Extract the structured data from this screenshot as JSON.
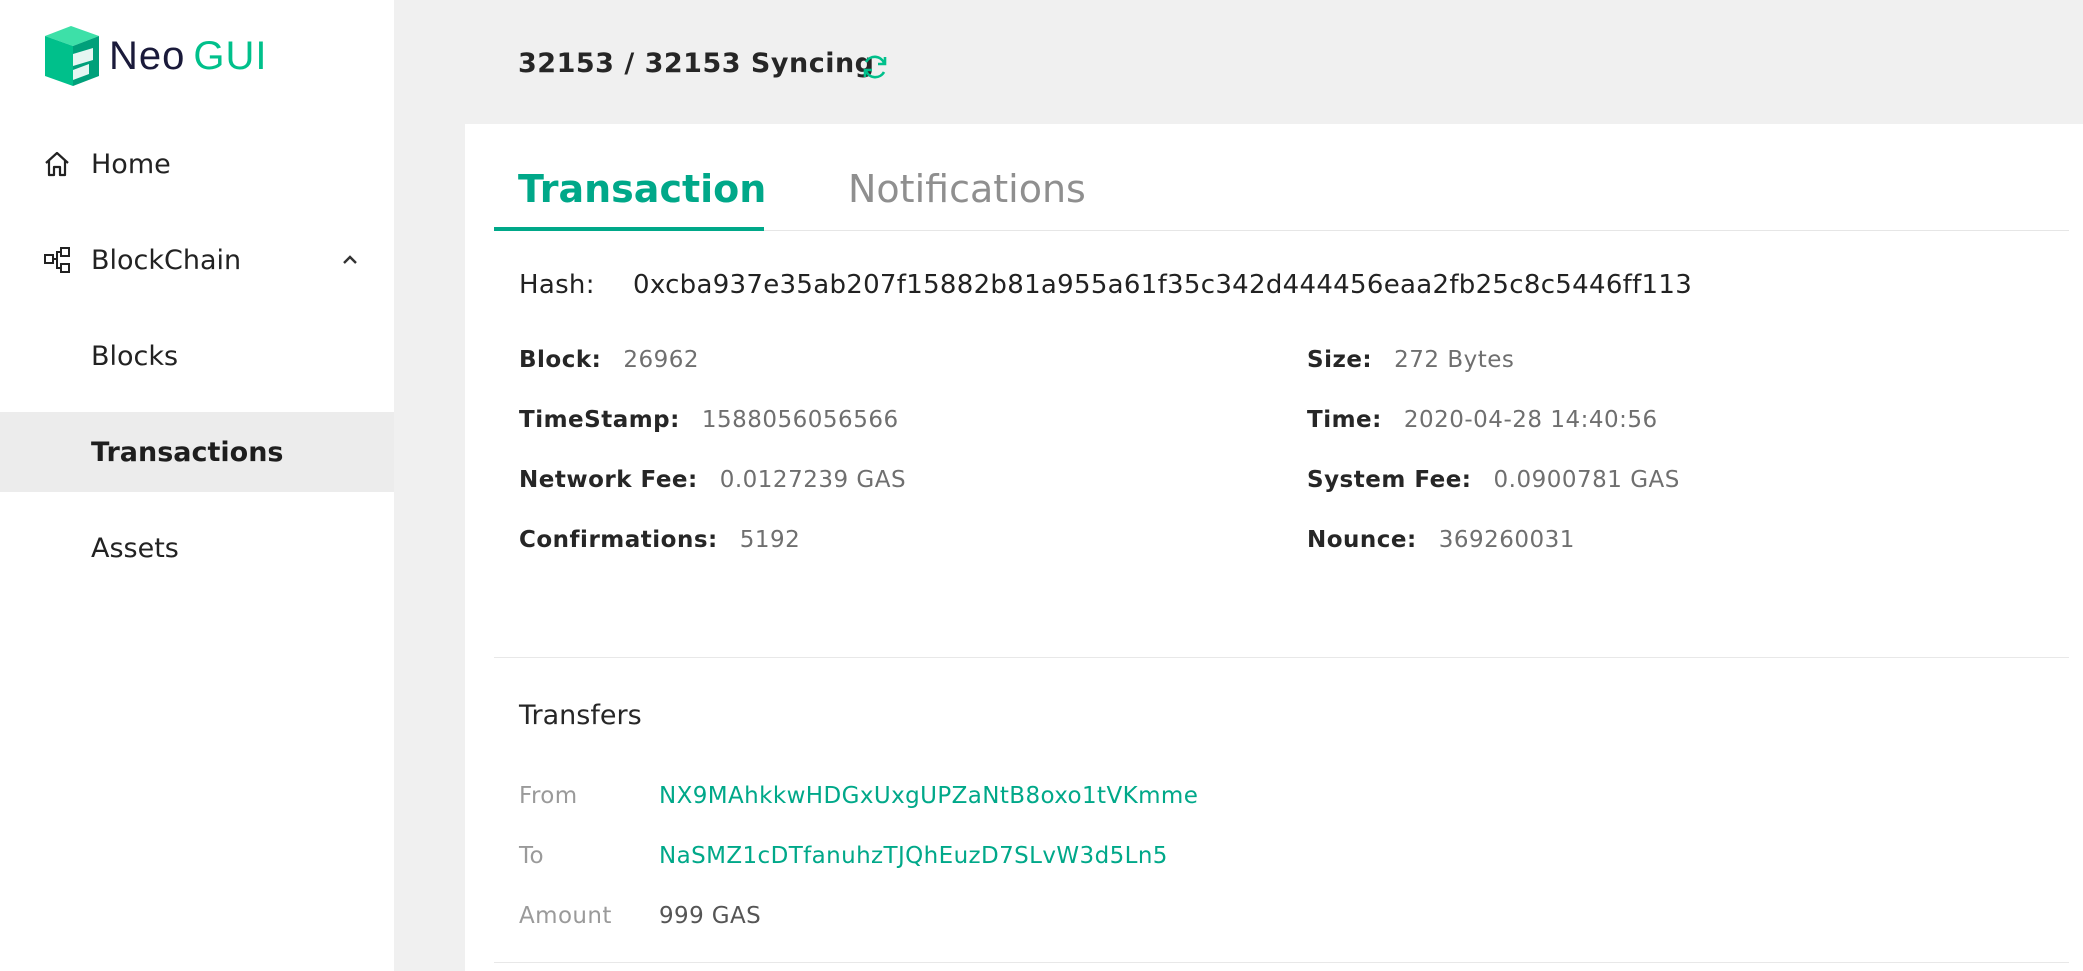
{
  "app": {
    "logo_part1": "Neo",
    "logo_part2": "GUI"
  },
  "sidebar": {
    "items": [
      {
        "label": "Home"
      },
      {
        "label": "BlockChain"
      },
      {
        "label": "Blocks"
      },
      {
        "label": "Transactions"
      },
      {
        "label": "Assets"
      }
    ]
  },
  "header": {
    "sync_status": "32153 / 32153 Syncing"
  },
  "tabs": [
    {
      "label": "Transaction"
    },
    {
      "label": "Notifications"
    }
  ],
  "transaction": {
    "hash_label": "Hash:",
    "hash": "0xcba937e35ab207f15882b81a955a61f35c342d444456eaa2fb25c8c5446ff113",
    "fields": {
      "block": {
        "label": "Block:",
        "value": "26962"
      },
      "size": {
        "label": "Size:",
        "value": "272 Bytes"
      },
      "timestamp": {
        "label": "TimeStamp:",
        "value": "1588056056566"
      },
      "time": {
        "label": "Time:",
        "value": "2020-04-28 14:40:56"
      },
      "network_fee": {
        "label": "Network Fee:",
        "value": "0.0127239 GAS"
      },
      "system_fee": {
        "label": "System Fee:",
        "value": "0.0900781 GAS"
      },
      "confirmations": {
        "label": "Confirmations:",
        "value": "5192"
      },
      "nounce": {
        "label": "Nounce:",
        "value": "369260031"
      }
    }
  },
  "transfers": {
    "title": "Transfers",
    "from_label": "From",
    "from": "NX9MAhkkwHDGxUxgUPZaNtB8oxo1tVKmme",
    "to_label": "To",
    "to": "NaSMZ1cDTfanuhzTJQhEuzD7SLvW3d5Ln5",
    "amount_label": "Amount",
    "amount": "999 GAS"
  },
  "colors": {
    "accent": "#00a889",
    "logo_green": "#00c08b"
  }
}
